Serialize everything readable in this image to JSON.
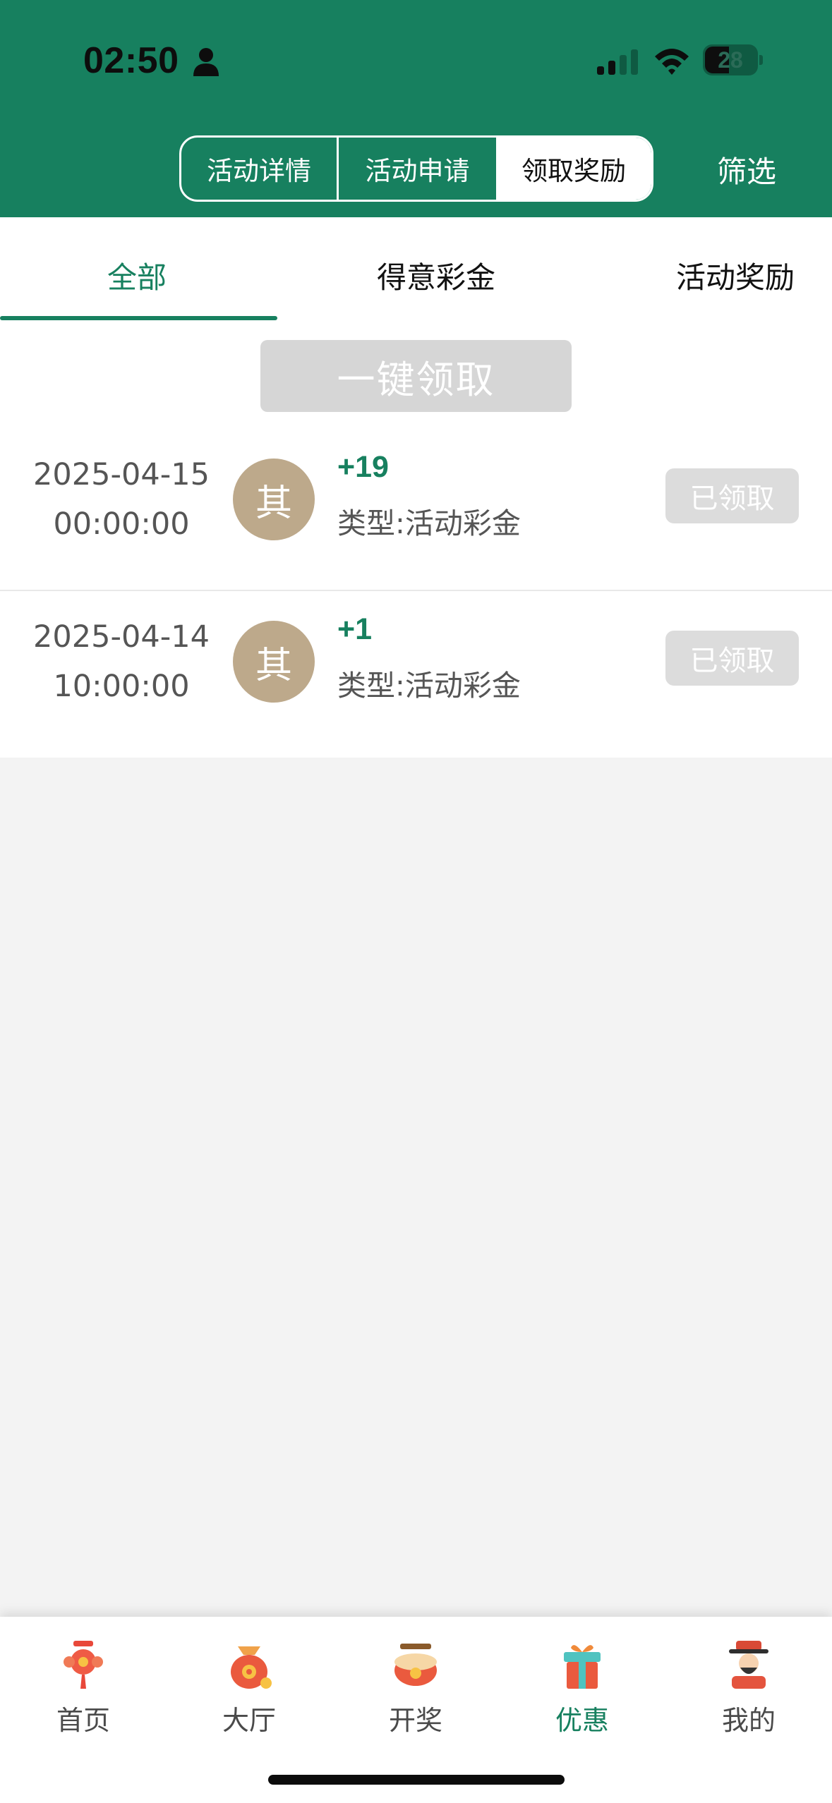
{
  "status_bar": {
    "time": "02:50",
    "battery": "28",
    "icons": [
      "person-icon",
      "signal-icon",
      "wifi-icon",
      "battery-icon"
    ]
  },
  "header": {
    "segments": [
      {
        "label": "活动详情",
        "selected": false
      },
      {
        "label": "活动申请",
        "selected": false
      },
      {
        "label": "领取奖励",
        "selected": true
      }
    ],
    "filter_label": "筛选"
  },
  "subtabs": [
    {
      "label": "全部",
      "active": true
    },
    {
      "label": "得意彩金",
      "active": false
    },
    {
      "label": "活动奖励",
      "active": false
    }
  ],
  "claim_all_label": "一键领取",
  "records": [
    {
      "date": "2025-04-15",
      "time": "00:00:00",
      "avatar": "其",
      "amount": "+19",
      "type": "类型:活动彩金",
      "status": "已领取"
    },
    {
      "date": "2025-04-14",
      "time": "10:00:00",
      "avatar": "其",
      "amount": "+1",
      "type": "类型:活动彩金",
      "status": "已领取"
    }
  ],
  "tabbar": [
    {
      "label": "首页",
      "icon": "knot-icon",
      "active": false
    },
    {
      "label": "大厅",
      "icon": "money-bag-icon",
      "active": false
    },
    {
      "label": "开奖",
      "icon": "drum-icon",
      "active": false
    },
    {
      "label": "优惠",
      "icon": "gift-icon",
      "active": true
    },
    {
      "label": "我的",
      "icon": "fortune-god-icon",
      "active": false
    }
  ],
  "colors": {
    "brand_green": "#17805f",
    "avatar_tan": "#bda98b",
    "disabled_gray": "#d6d6d6",
    "page_bg": "#f3f3f3"
  }
}
